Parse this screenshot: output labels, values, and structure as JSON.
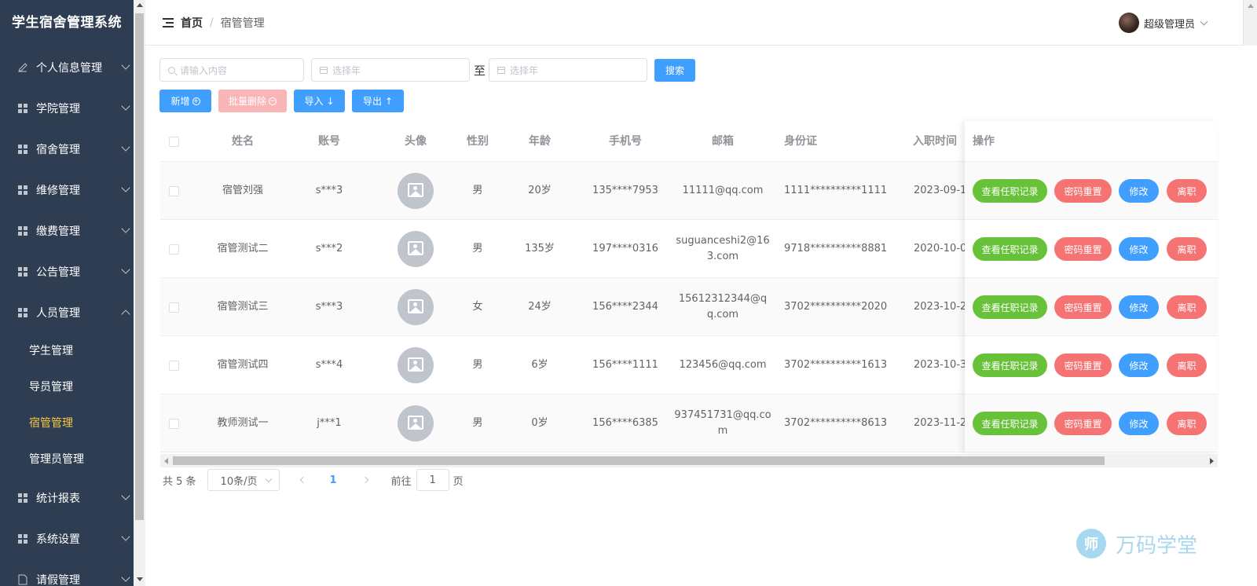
{
  "app_title": "学生宿舍管理系统",
  "sidebar": {
    "items": [
      {
        "label": "个人信息管理",
        "icon": "edit-icon",
        "expanded": false
      },
      {
        "label": "学院管理",
        "icon": "grid-icon",
        "expanded": false
      },
      {
        "label": "宿舍管理",
        "icon": "grid-icon",
        "expanded": false
      },
      {
        "label": "维修管理",
        "icon": "grid-icon",
        "expanded": false
      },
      {
        "label": "缴费管理",
        "icon": "grid-icon",
        "expanded": false
      },
      {
        "label": "公告管理",
        "icon": "grid-icon",
        "expanded": false
      },
      {
        "label": "人员管理",
        "icon": "grid-icon",
        "expanded": true
      },
      {
        "label": "统计报表",
        "icon": "grid-icon",
        "expanded": false
      },
      {
        "label": "系统设置",
        "icon": "grid-icon",
        "expanded": false
      },
      {
        "label": "请假管理",
        "icon": "document-icon",
        "expanded": false
      }
    ],
    "subitems": [
      {
        "label": "学生管理",
        "active": false
      },
      {
        "label": "导员管理",
        "active": false
      },
      {
        "label": "宿管管理",
        "active": true
      },
      {
        "label": "管理员管理",
        "active": false
      }
    ],
    "active_color": "#f7c844",
    "bg_color": "#2e3d52"
  },
  "header": {
    "breadcrumb_home": "首页",
    "breadcrumb_sep": "/",
    "breadcrumb_current": "宿管管理",
    "user_name": "超级管理员"
  },
  "toolbar": {
    "search_placeholder": "请输入内容",
    "date_start_placeholder": "选择年",
    "date_end_placeholder": "选择年",
    "range_sep": "至",
    "search_label": "搜索",
    "add_label": "新增",
    "batch_delete_label": "批量删除",
    "import_label": "导入",
    "export_label": "导出"
  },
  "table": {
    "columns": [
      "姓名",
      "账号",
      "头像",
      "性别",
      "年龄",
      "手机号",
      "邮箱",
      "身份证",
      "入职时间",
      "操作"
    ],
    "rows": [
      {
        "name": "宿管刘强",
        "account": "s***3",
        "gender": "男",
        "age": "20岁",
        "phone": "135****7953",
        "email": "11111@qq.com",
        "id_card": "1111**********1111",
        "hire_date": "2023-09-1"
      },
      {
        "name": "宿管测试二",
        "account": "s***2",
        "gender": "男",
        "age": "135岁",
        "phone": "197****0316",
        "email": "suguanceshi2@163.com",
        "id_card": "9718**********8881",
        "hire_date": "2020-10-0"
      },
      {
        "name": "宿管测试三",
        "account": "s***3",
        "gender": "女",
        "age": "24岁",
        "phone": "156****2344",
        "email": "15612312344@qq.com",
        "id_card": "3702**********2020",
        "hire_date": "2023-10-2"
      },
      {
        "name": "宿管测试四",
        "account": "s***4",
        "gender": "男",
        "age": "6岁",
        "phone": "156****1111",
        "email": "123456@qq.com",
        "id_card": "3702**********1613",
        "hire_date": "2023-10-3"
      },
      {
        "name": "教师测试一",
        "account": "j***1",
        "gender": "男",
        "age": "0岁",
        "phone": "156****6385",
        "email": "937451731@qq.com",
        "id_card": "3702**********8613",
        "hire_date": "2023-11-2"
      }
    ],
    "actions": {
      "history": "查看任职记录",
      "reset_password": "密码重置",
      "edit": "修改",
      "resign": "离职"
    }
  },
  "pagination": {
    "total_text": "共 5 条",
    "page_size": "10条/页",
    "current_page": "1",
    "goto_label": "前往",
    "goto_value": "1",
    "page_suffix": "页"
  },
  "watermark": {
    "logo_glyph": "师",
    "text": "万码学堂"
  },
  "colors": {
    "primary": "#409eff",
    "success": "#67c23a",
    "danger": "#f56c6c",
    "danger_light": "#fab6b6"
  }
}
